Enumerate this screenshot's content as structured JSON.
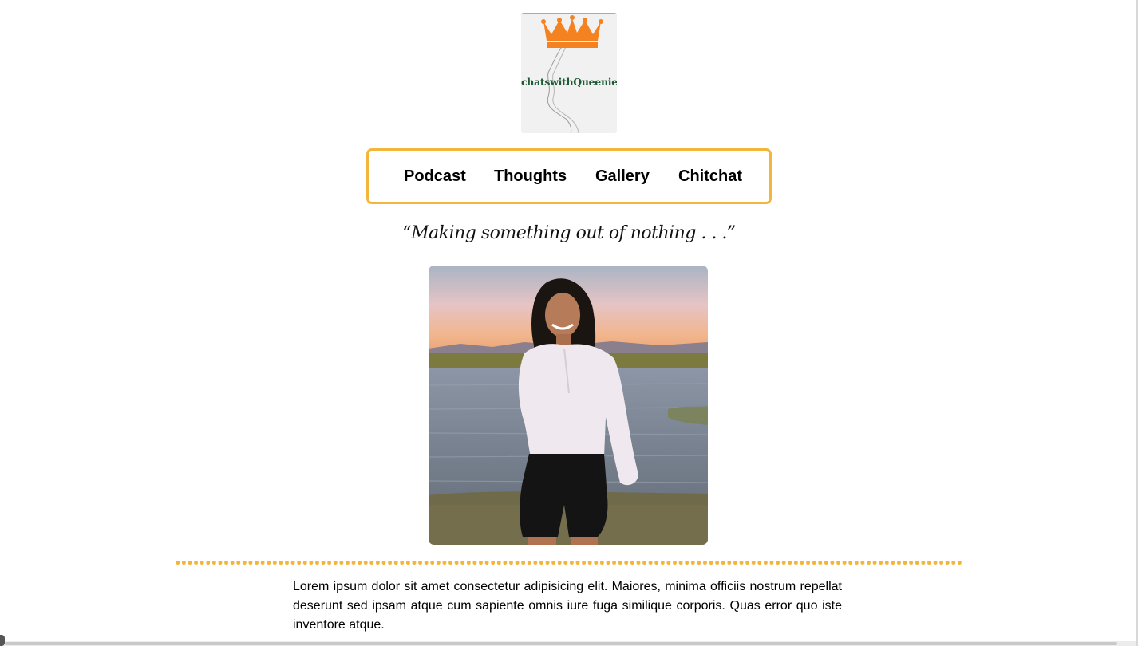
{
  "logo": {
    "text": "chatswithQueenie",
    "icon": "crown-icon",
    "crown_color": "#f58220",
    "text_color": "#1e5a35"
  },
  "nav": {
    "items": [
      {
        "label": "Podcast"
      },
      {
        "label": "Thoughts"
      },
      {
        "label": "Gallery"
      },
      {
        "label": "Chitchat"
      }
    ],
    "border_color": "#f4b63a"
  },
  "tagline": "“Making something out of nothing . . .”",
  "hero_photo": {
    "icon": "portrait-photo"
  },
  "divider": {
    "color": "#f4b63a",
    "style": "dotted"
  },
  "intro_text": "Lorem ipsum dolor sit amet consectetur adipisicing elit. Maiores, minima officiis nostrum repellat deserunt sed ipsam atque cum sapiente omnis iure fuga similique corporis. Quas error quo iste inventore atque."
}
